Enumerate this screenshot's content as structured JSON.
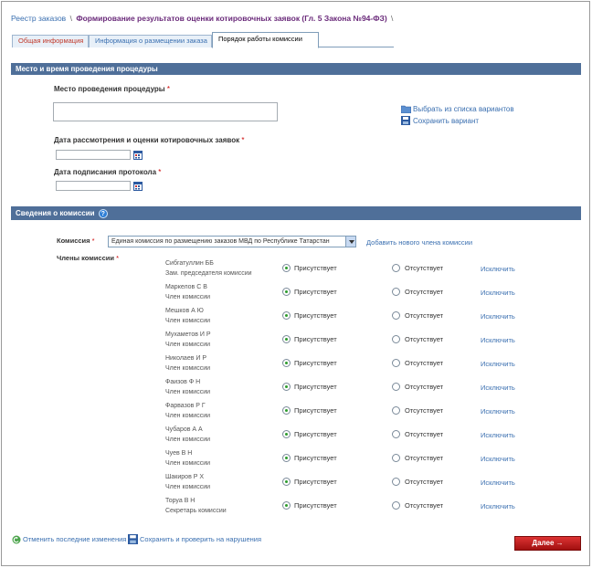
{
  "breadcrumb": {
    "root": "Реестр заказов",
    "sep1": "\\",
    "current": "Формирование результатов оценки котировочных заявок (Гл. 5 Закона №94-ФЗ)",
    "sep2": "\\"
  },
  "tabs": [
    {
      "label": "Общая информация"
    },
    {
      "label": "Информация о размещении заказа"
    },
    {
      "label": "Порядок работы комиссии"
    }
  ],
  "section1": {
    "title": "Место и время проведения процедуры",
    "place_label": "Место проведения процедуры",
    "req": "*",
    "pick_link": "Выбрать из списка вариантов",
    "save_variant_link": "Сохранить вариант",
    "review_date_label": "Дата рассмотрения и оценки котировочных заявок",
    "sign_date_label": "Дата подписания протокола"
  },
  "section2": {
    "title": "Сведения о комиссии",
    "help": "?",
    "commission_label": "Комиссия",
    "commission_value": "Единая комиссия по размещению заказов МВД по Республике Татарстан",
    "add_member_link": "Добавить нового члена комиссии",
    "members_label": "Члены комиссии"
  },
  "options": {
    "present": "Присутствует",
    "absent": "Отсутствует",
    "exclude": "Исключить"
  },
  "members": [
    {
      "name": "Сибгатуллин ББ",
      "role": "Зам. председателя комиссии"
    },
    {
      "name": "Маркелов С В",
      "role": "Член комиссии"
    },
    {
      "name": "Мешков А Ю",
      "role": "Член комиссии"
    },
    {
      "name": "Мухаметов И Р",
      "role": "Член комиссии"
    },
    {
      "name": "Николаев И Р",
      "role": "Член комиссии"
    },
    {
      "name": "Фаизов Ф Н",
      "role": "Член комиссии"
    },
    {
      "name": "Фарвазов Р Г",
      "role": "Член комиссии"
    },
    {
      "name": "Чубаров А А",
      "role": "Член комиссии"
    },
    {
      "name": "Чуев В Н",
      "role": "Член комиссии"
    },
    {
      "name": "Шакиров Р Х",
      "role": "Член комиссии"
    },
    {
      "name": "Торуа В Н",
      "role": "Секретарь комиссии"
    }
  ],
  "bottom": {
    "undo": "Отменить последние изменения",
    "save_check": "Сохранить и проверить на нарушения",
    "next": "Далее →"
  }
}
